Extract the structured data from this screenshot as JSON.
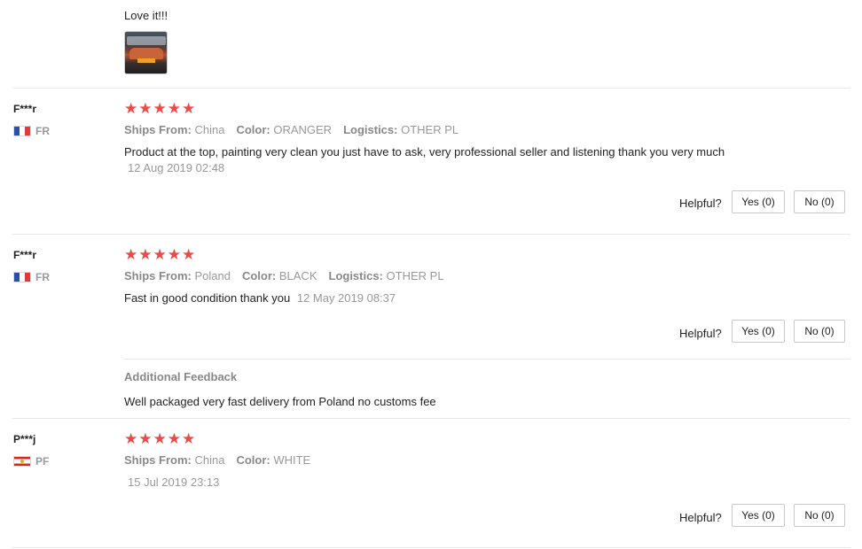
{
  "top": {
    "text": "Love it!!!"
  },
  "helpful_label": "Helpful?",
  "additional_label": "Additional Feedback",
  "labels": {
    "ships_from": "Ships From:",
    "color": "Color:",
    "logistics": "Logistics:"
  },
  "stars_glyph": "★★★★★",
  "reviews": [
    {
      "user": "F***r",
      "country": "FR",
      "rating": 5,
      "ships_from": "China",
      "color": "ORANGER",
      "logistics": "OTHER PL",
      "text": "Product at the top, painting very clean you just have to ask, very professional seller and listening thank you very much",
      "date": "12 Aug 2019 02:48",
      "yes": "Yes (0)",
      "no": "No (0)"
    },
    {
      "user": "F***r",
      "country": "FR",
      "rating": 5,
      "ships_from": "Poland",
      "color": "BLACK",
      "logistics": "OTHER PL",
      "text": "Fast in good condition thank you",
      "date": "12 May 2019 08:37",
      "yes": "Yes (0)",
      "no": "No (0)",
      "additional_feedback": "Well packaged very fast delivery from Poland no customs fee"
    },
    {
      "user": "P***j",
      "country": "PF",
      "rating": 5,
      "ships_from": "China",
      "color": "WHITE",
      "date": "15 Jul 2019 23:13",
      "yes": "Yes (0)",
      "no": "No (0)"
    }
  ]
}
